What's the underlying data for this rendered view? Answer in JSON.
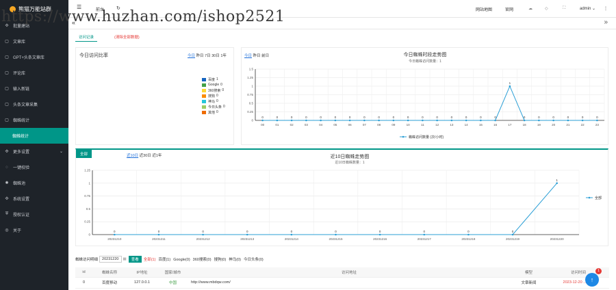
{
  "watermark": "https://www.huzhan.com/ishop2521",
  "sidebar": {
    "app_title": "熊猫万能站群",
    "items": [
      {
        "label": "批量建站",
        "icon": "gear-icon"
      },
      {
        "label": "文章库",
        "icon": "doc-icon"
      },
      {
        "label": "GPT+头条文章库",
        "icon": "doc-icon"
      },
      {
        "label": "评论库",
        "icon": "doc-icon"
      },
      {
        "label": "输入新链",
        "icon": "doc-icon"
      },
      {
        "label": "头条文章采集",
        "icon": "doc-icon"
      },
      {
        "label": "蜘蛛统计",
        "icon": "doc-icon"
      },
      {
        "label": "蜘蛛统计",
        "icon": "none",
        "active": true
      },
      {
        "label": "更多设置",
        "icon": "gear-icon",
        "caret": "⌄"
      },
      {
        "label": "一键校验",
        "icon": "check-icon"
      },
      {
        "label": "蜘蛛池",
        "icon": "spider-icon"
      },
      {
        "label": "系统设置",
        "icon": "gear-icon"
      },
      {
        "label": "授权认证",
        "icon": "shield-icon"
      },
      {
        "label": "关于",
        "icon": "info-icon"
      }
    ]
  },
  "topbar": {
    "menu_icon": "☰",
    "home": "前台",
    "refresh_icon": "↻",
    "site_map": "网站地图",
    "official": "官网",
    "admin": "admin ⌄",
    "more": "⋮",
    "double_chevron": "»"
  },
  "tabs": {
    "first": "«"
  },
  "subtabs": {
    "record": "访问记录",
    "clear": "(清除全部数据)"
  },
  "rate_panel": {
    "title": "今日访问比率",
    "filters": [
      "今日",
      "昨日",
      "7日",
      "30日",
      "1年"
    ],
    "legend": [
      {
        "name": "百度",
        "value": "1",
        "color": "#1565c0"
      },
      {
        "name": "Google",
        "value": "0",
        "color": "#43a047"
      },
      {
        "name": "360搜索",
        "value": "0",
        "color": "#fdd835"
      },
      {
        "name": "搜狗",
        "value": "0",
        "color": "#fb8c00"
      },
      {
        "name": "神马",
        "value": "0",
        "color": "#26c6da"
      },
      {
        "name": "今日头条",
        "value": "0",
        "color": "#9ccc65"
      },
      {
        "name": "其他",
        "value": "0",
        "color": "#ef6c00"
      }
    ]
  },
  "hourly_panel": {
    "filters": [
      "今日",
      "昨日",
      "前日"
    ],
    "title": "今日蜘蛛时段走势图",
    "subtitle": "今日蜘蛛访问数量：1",
    "legend": "蜘蛛访问数量 (次/小时)"
  },
  "daily_panel": {
    "badge": "全部",
    "filters": [
      "近10日",
      "近30日",
      "近1年"
    ],
    "title": "近10日蜘蛛走势图",
    "subtitle": "近10日蜘蛛数量：1",
    "legend": "全部"
  },
  "filter": {
    "label": "蜘蛛访问明细",
    "date": "20231220",
    "calendar_icon": "▦",
    "button": "查看",
    "options": [
      "全部(1)",
      "百度(1)",
      "Google(0)",
      "360搜索(0)",
      "搜狗(0)",
      "神马(0)",
      "今日头条(0)"
    ]
  },
  "table": {
    "headers": [
      "id",
      "蜘蛛名称",
      "IP地址",
      "国家/城市",
      "访问地址",
      "模型",
      "访问时间"
    ],
    "rows": [
      {
        "id": "0",
        "name": "百度移动",
        "ip": "127.0.0.1",
        "city": "中国",
        "url": "http://www.mbdqw.com/",
        "model": "文章新闻",
        "time": "2023-12-20 ...0:26"
      }
    ]
  },
  "float": {
    "icon": "↑",
    "badge": "1"
  },
  "chart_data": [
    {
      "type": "line",
      "title": "今日蜘蛛时段走势图",
      "subtitle": "今日蜘蛛访问数量：1",
      "categories": [
        "00",
        "01",
        "02",
        "03",
        "04",
        "05",
        "06",
        "07",
        "08",
        "09",
        "10",
        "11",
        "12",
        "13",
        "14",
        "15",
        "16",
        "17",
        "18",
        "19",
        "20",
        "21",
        "22",
        "23"
      ],
      "series": [
        {
          "name": "蜘蛛访问数量 (次/小时)",
          "values": [
            0,
            0,
            0,
            0,
            0,
            0,
            0,
            0,
            0,
            0,
            0,
            0,
            0,
            0,
            0,
            0,
            0,
            1,
            0,
            0,
            0,
            0,
            0,
            0
          ]
        }
      ],
      "ylim": [
        0,
        1.5
      ],
      "yticks": [
        "0",
        "0.25",
        "0.5",
        "0.75",
        "1",
        "1.25",
        "1.5"
      ],
      "grid": true,
      "legend": "bottom",
      "color": "#2b9fd6"
    },
    {
      "type": "line",
      "title": "近10日蜘蛛走势图",
      "subtitle": "近10日蜘蛛数量：1",
      "categories": [
        "20231210",
        "20231211",
        "20231212",
        "20231213",
        "20231214",
        "20231215",
        "20231216",
        "20231217",
        "20231218",
        "20231219",
        "20231220"
      ],
      "series": [
        {
          "name": "全部",
          "values": [
            0,
            0,
            0,
            0,
            0,
            0,
            0,
            0,
            0,
            0,
            1
          ]
        }
      ],
      "ylim": [
        0,
        1.25
      ],
      "yticks": [
        "0",
        "0.25",
        "0.5",
        "0.75",
        "1",
        "1.25"
      ],
      "grid": true,
      "legend": "right",
      "color": "#2b9fd6"
    }
  ]
}
